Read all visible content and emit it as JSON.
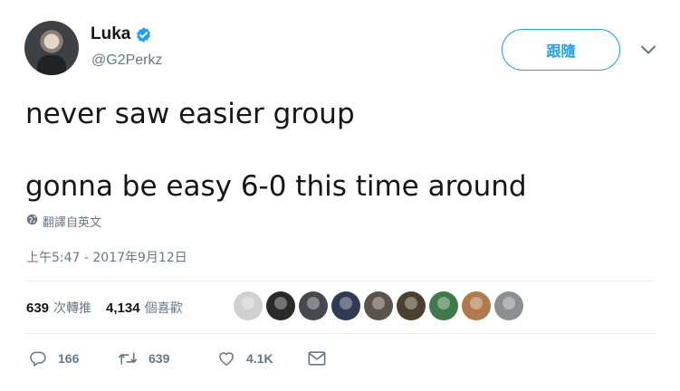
{
  "user": {
    "display_name": "Luka",
    "handle": "@G2Perkz",
    "avatar_icon": "user-avatar-photo"
  },
  "follow_button": {
    "label": "跟隨"
  },
  "menu_icon": "chevron-down-icon",
  "tweet": {
    "lines": [
      "never saw easier group",
      "gonna be easy 6-0 this time around"
    ]
  },
  "translate": {
    "icon": "globe-icon",
    "label": "翻譯自英文"
  },
  "timestamp": "上午5:47 - 2017年9月12日",
  "stats": {
    "retweets": {
      "count": "639",
      "label": "次轉推"
    },
    "likes": {
      "count": "4,134",
      "label": "個喜歡"
    }
  },
  "likers": [
    "#d0d0d0",
    "#2a2a2a",
    "#444a4f",
    "#2f3a55",
    "#5c534c",
    "#4a4030",
    "#3f7a4a",
    "#b07a4a",
    "#8a8f94"
  ],
  "actions": {
    "reply": {
      "icon": "reply-icon",
      "count": "166"
    },
    "retweet": {
      "icon": "retweet-icon",
      "count": "639"
    },
    "like": {
      "icon": "heart-icon",
      "count": "4.1K"
    },
    "dm": {
      "icon": "envelope-icon"
    }
  },
  "colors": {
    "accent": "#1da1f2",
    "muted": "#657786",
    "text": "#14171a",
    "divider": "#e6ecf0"
  }
}
